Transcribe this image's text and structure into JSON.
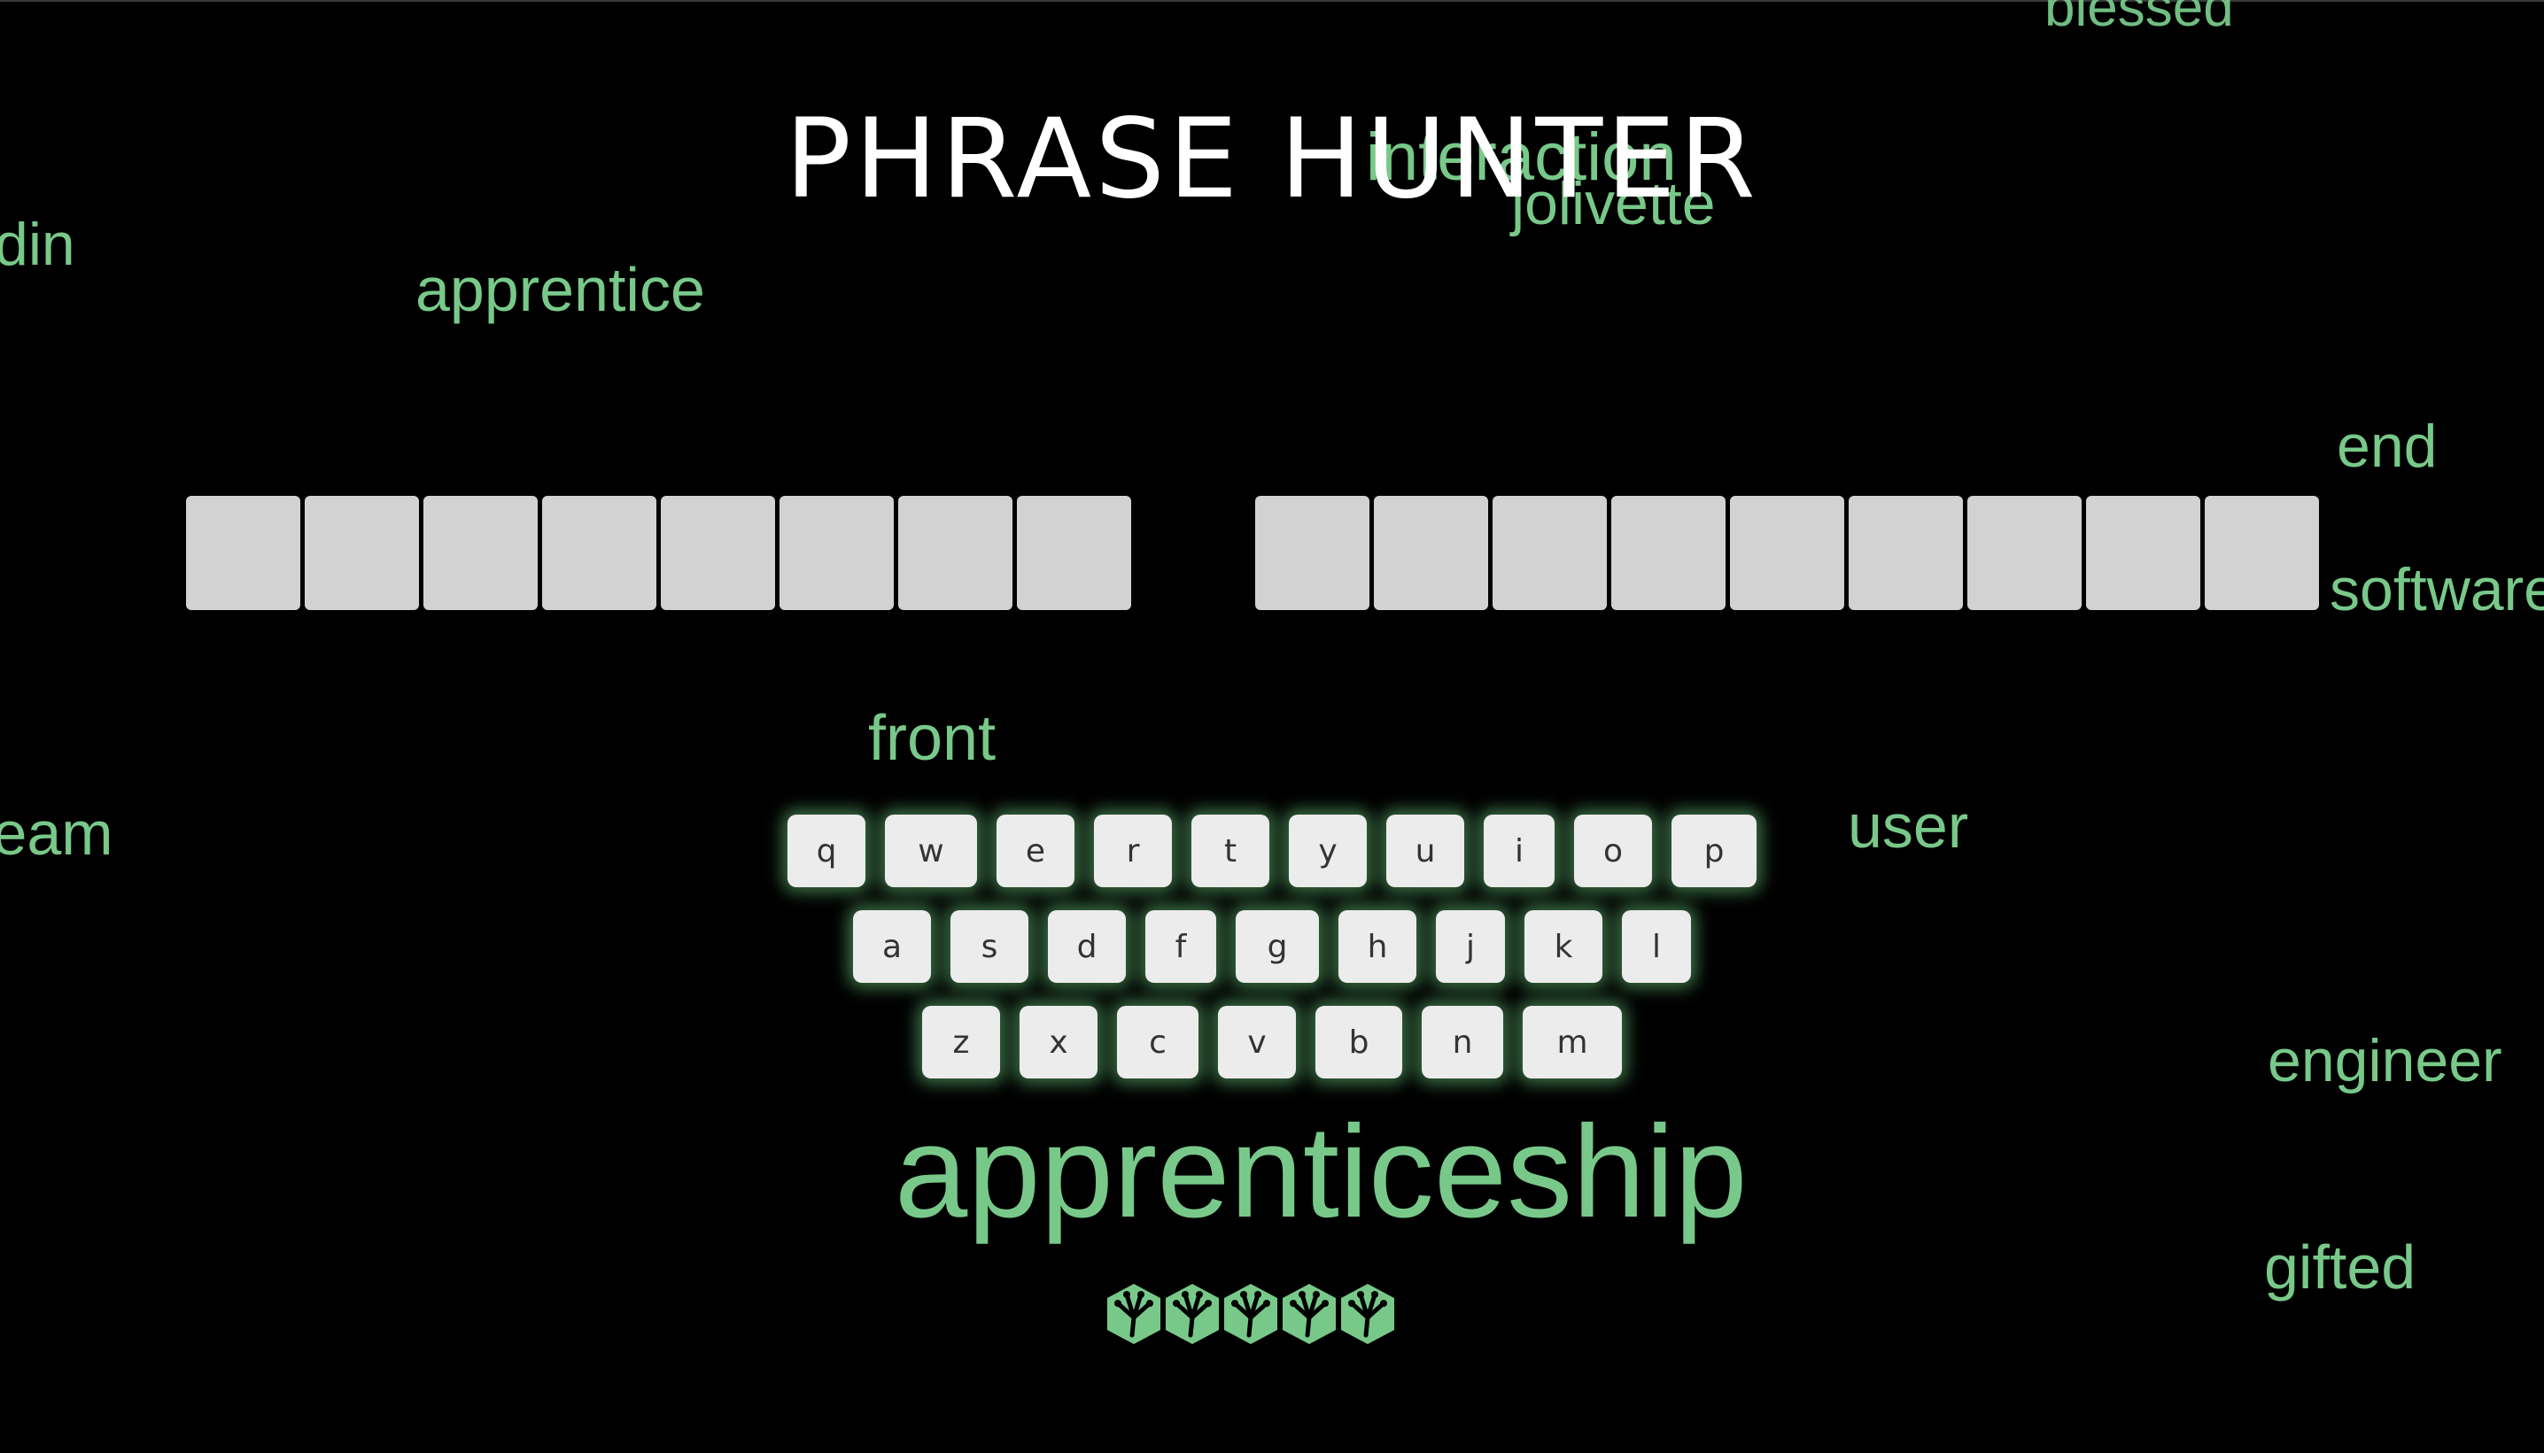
{
  "app": {
    "title": "PHRASE HUNTER"
  },
  "background_words": [
    {
      "id": "blessed",
      "text": "blessed"
    },
    {
      "id": "interaction",
      "text": "interaction"
    },
    {
      "id": "jolivette",
      "text": "jolivette"
    },
    {
      "id": "din",
      "text": "din"
    },
    {
      "id": "apprentice",
      "text": "apprentice"
    },
    {
      "id": "end",
      "text": "end"
    },
    {
      "id": "software",
      "text": "software"
    },
    {
      "id": "front",
      "text": "front"
    },
    {
      "id": "team",
      "text": "team"
    },
    {
      "id": "user",
      "text": "user"
    },
    {
      "id": "engineer",
      "text": "engineer"
    },
    {
      "id": "apprenticeship",
      "text": "apprenticeship"
    },
    {
      "id": "gifted",
      "text": "gifted"
    }
  ],
  "phrase": {
    "words": [
      {
        "letters": [
          "",
          "",
          "",
          "",
          "",
          "",
          "",
          ""
        ]
      },
      {
        "letters": [
          "",
          "",
          "",
          "",
          "",
          "",
          "",
          "",
          ""
        ]
      }
    ]
  },
  "keyboard": {
    "rows": [
      [
        "q",
        "w",
        "e",
        "r",
        "t",
        "y",
        "u",
        "i",
        "o",
        "p"
      ],
      [
        "a",
        "s",
        "d",
        "f",
        "g",
        "h",
        "j",
        "k",
        "l"
      ],
      [
        "z",
        "x",
        "c",
        "v",
        "b",
        "n",
        "m"
      ]
    ]
  },
  "lives": {
    "remaining": 5,
    "total": 5,
    "icon": "gecko-foot-icon",
    "color": "#78c989"
  },
  "colors": {
    "background": "#000000",
    "accent_green": "#78c989",
    "tile": "#d2d2d2",
    "key": "#ececec",
    "title": "#ffffff"
  }
}
